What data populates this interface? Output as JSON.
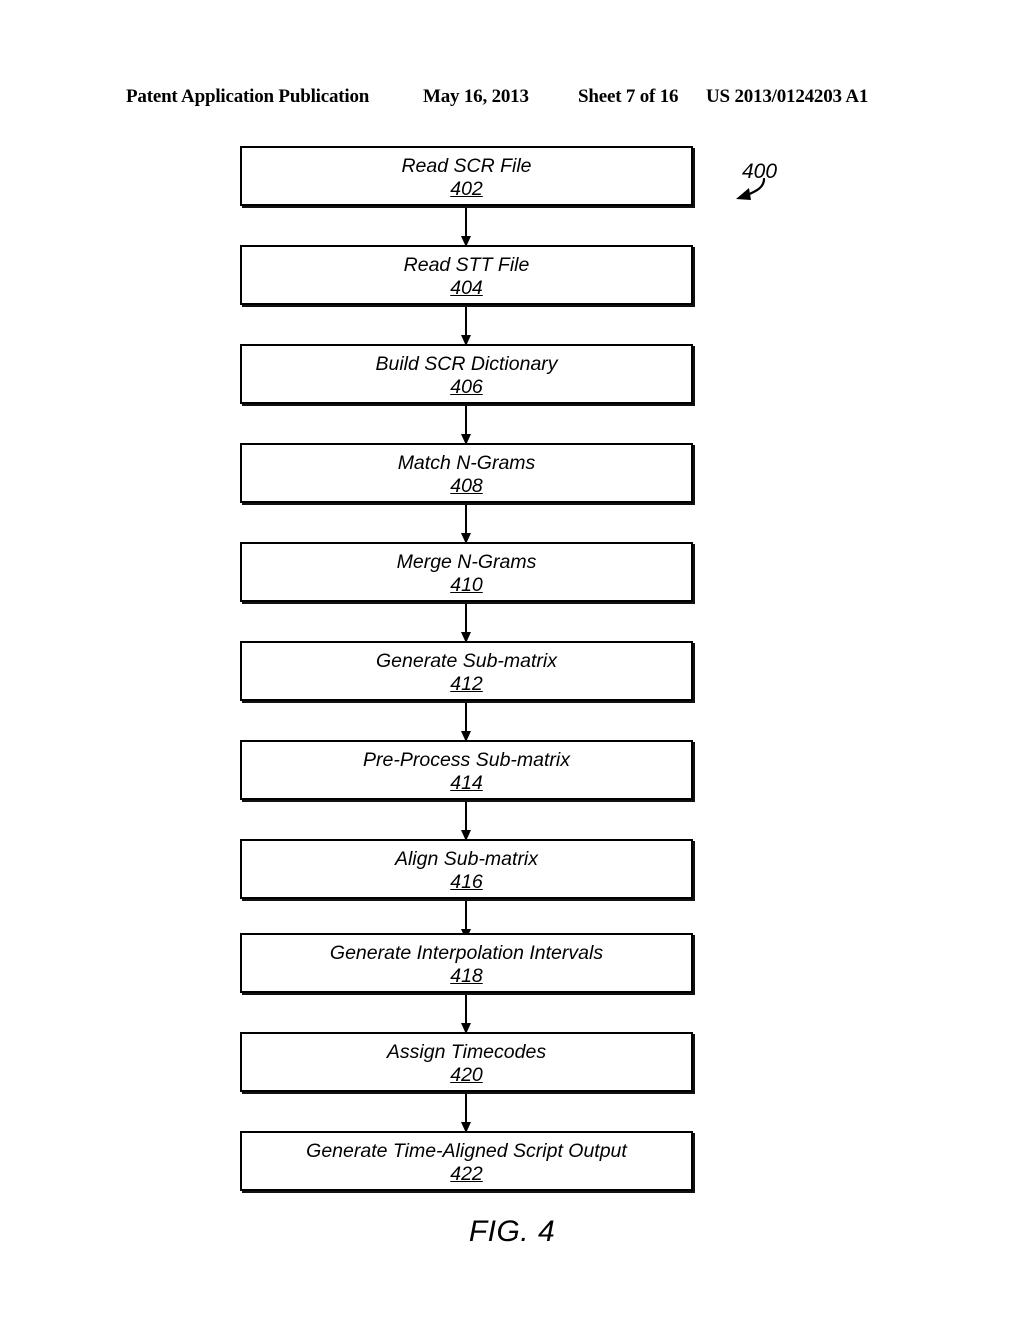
{
  "header": {
    "publication": "Patent Application Publication",
    "date": "May 16, 2013",
    "sheet": "Sheet 7 of 16",
    "patent_number": "US 2013/0124203 A1"
  },
  "figure": {
    "caption": "FIG. 4",
    "diagram_reference": "400",
    "colors": {
      "ink": "#000000",
      "background": "#ffffff"
    }
  },
  "flowchart": {
    "type": "flowchart",
    "orientation": "top-to-bottom",
    "nodes": [
      {
        "label": "Read SCR File",
        "ref": "402"
      },
      {
        "label": "Read STT File",
        "ref": "404"
      },
      {
        "label": "Build SCR Dictionary",
        "ref": "406"
      },
      {
        "label": "Match N-Grams",
        "ref": "408"
      },
      {
        "label": "Merge N-Grams",
        "ref": "410"
      },
      {
        "label": "Generate Sub-matrix",
        "ref": "412"
      },
      {
        "label": "Pre-Process Sub-matrix",
        "ref": "414"
      },
      {
        "label": "Align Sub-matrix",
        "ref": "416"
      },
      {
        "label": "Generate Interpolation Intervals",
        "ref": "418"
      },
      {
        "label": "Assign Timecodes",
        "ref": "420"
      },
      {
        "label": "Generate Time-Aligned Script Output",
        "ref": "422"
      }
    ],
    "edges": [
      {
        "from": "402",
        "to": "404"
      },
      {
        "from": "404",
        "to": "406"
      },
      {
        "from": "406",
        "to": "408"
      },
      {
        "from": "408",
        "to": "410"
      },
      {
        "from": "410",
        "to": "412"
      },
      {
        "from": "412",
        "to": "414"
      },
      {
        "from": "414",
        "to": "416"
      },
      {
        "from": "416",
        "to": "418"
      },
      {
        "from": "418",
        "to": "420"
      },
      {
        "from": "420",
        "to": "422"
      }
    ]
  }
}
